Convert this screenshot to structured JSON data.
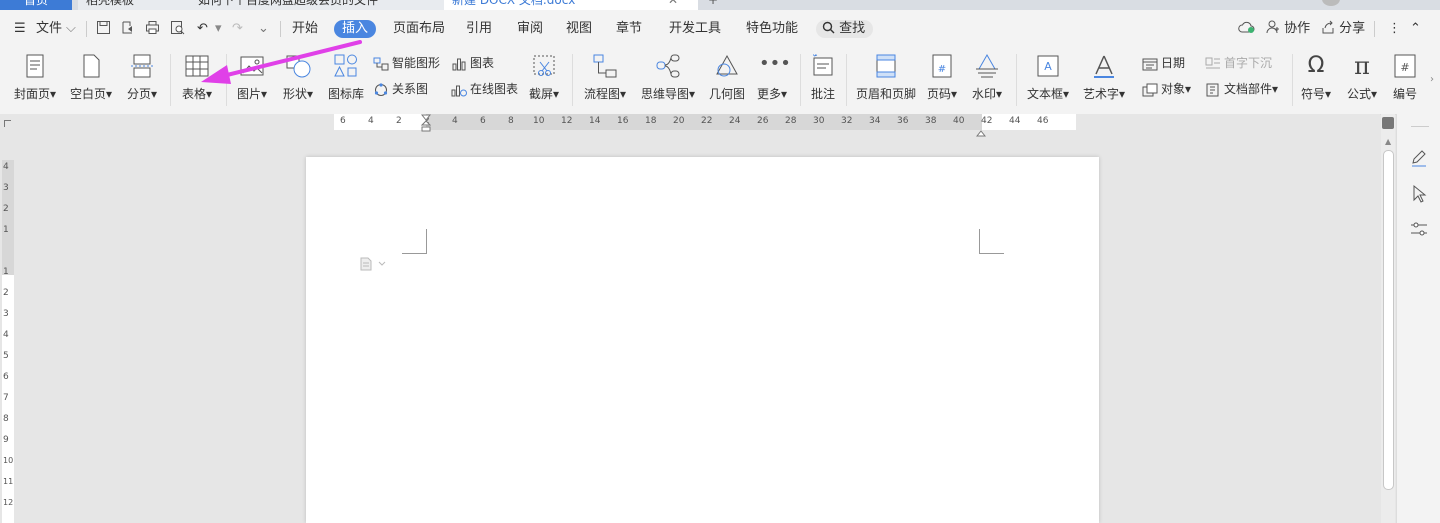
{
  "window_tabs": [
    {
      "label": "首页"
    },
    {
      "label": "稻壳模板"
    },
    {
      "label": "如何下个百度网盘超级会员的文件"
    },
    {
      "label": "新建 DOCX 文档.docx"
    }
  ],
  "menubar": {
    "file_label": "文件",
    "tabs": [
      "开始",
      "插入",
      "页面布局",
      "引用",
      "审阅",
      "视图",
      "章节",
      "开发工具",
      "特色功能"
    ],
    "active_tab": "插入",
    "search_label": "查找",
    "collab_label": "协作",
    "share_label": "分享"
  },
  "ribbon": {
    "cover": "封面页",
    "blank": "空白页",
    "pagebreak": "分页",
    "table": "表格",
    "picture": "图片",
    "shape": "形状",
    "iconlib": "图标库",
    "smartart": "智能图形",
    "chart": "图表",
    "relation": "关系图",
    "onlinechart": "在线图表",
    "screenshot": "截屏",
    "flowchart": "流程图",
    "mindmap": "思维导图",
    "geometry": "几何图",
    "more": "更多",
    "comment": "批注",
    "headerfooter": "页眉和页脚",
    "pagenum": "页码",
    "watermark": "水印",
    "textbox": "文本框",
    "wordart": "艺术字",
    "date": "日期",
    "dropcap": "首字下沉",
    "object": "对象",
    "docparts": "文档部件",
    "symbol": "符号",
    "formula": "公式",
    "numbering": "编号"
  },
  "ruler": {
    "h_ticks": [
      "6",
      "4",
      "2",
      "2",
      "4",
      "6",
      "8",
      "10",
      "12",
      "14",
      "16",
      "18",
      "20",
      "22",
      "24",
      "26",
      "28",
      "30",
      "32",
      "34",
      "36",
      "38",
      "40",
      "42",
      "44",
      "46"
    ],
    "v_ticks_top": [
      "4",
      "3",
      "2",
      "1"
    ],
    "v_ticks_bottom": [
      "1",
      "2",
      "3",
      "4",
      "5",
      "6",
      "7",
      "8",
      "9",
      "10",
      "11",
      "12"
    ]
  },
  "colors": {
    "accent": "#4a86e0",
    "annotation_arrow": "#e040e8"
  }
}
